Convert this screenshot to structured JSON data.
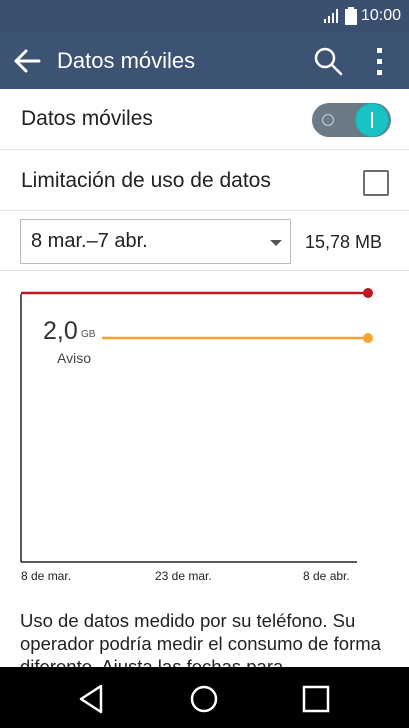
{
  "status_bar": {
    "time": "10:00"
  },
  "app_bar": {
    "title": "Datos móviles"
  },
  "mobile_data": {
    "label": "Datos móviles",
    "enabled": true
  },
  "limit_row": {
    "label": "Limitación de uso de datos",
    "checked": false
  },
  "cycle": {
    "selected": "8 mar.–7 abr.",
    "total": "15,78 MB"
  },
  "chart_data": {
    "type": "line",
    "x_ticks": [
      "8 de mar.",
      "23 de mar.",
      "8 de abr."
    ],
    "warning": {
      "value": "2,0",
      "unit": "GB",
      "label": "Aviso"
    },
    "colors": {
      "limit": "#c0161d",
      "warning": "#f5a431",
      "axis": "#222222"
    }
  },
  "footer": {
    "text": "Uso de datos medido por su teléfono. Su operador podría medir el consumo de forma diferente. Ajusta las fechas para"
  },
  "icons": {
    "back": "arrow-left-icon",
    "search": "search-icon",
    "more": "more-vert-icon",
    "nav_back": "triangle-back-icon",
    "nav_home": "circle-home-icon",
    "nav_recent": "square-recent-icon"
  }
}
